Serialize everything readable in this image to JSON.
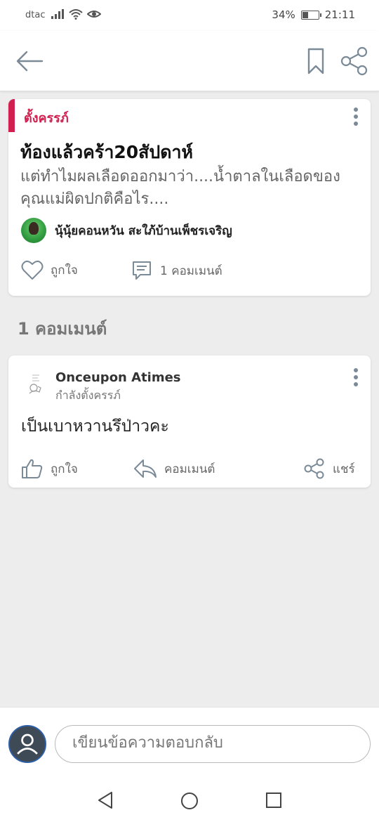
{
  "status_bar": {
    "carrier": "dtac",
    "battery_percent": "34%",
    "battery_level": 0.34,
    "time": "21:11",
    "icons": [
      "signal-icon",
      "wifi-icon",
      "eye-icon",
      "battery-icon"
    ]
  },
  "app_bar": {
    "icons": [
      "back-arrow-icon",
      "bookmark-icon",
      "share-icon"
    ]
  },
  "post": {
    "tag": "ตั้งครรภ์",
    "title": "ท้องแล้วคร้า20สัปดาห์",
    "excerpt": "แต่ทำไมผลเลือดออกมาว่า....น้ำตาลในเลือดของคุณแม่ผิดปกติคือไร....",
    "author": "นุ้นุ้ยคอนหวัน สะใภ้บ้านเพ็ชรเจริญ",
    "like_label": "ถูกใจ",
    "comment_label": "1 คอมเมนต์"
  },
  "comments_section": {
    "title": "1 คอมเมนต์"
  },
  "comment": {
    "author": "Onceupon Atimes",
    "status": "กำลังตั้งครรภ์",
    "text": "เป็นเบาหวานรึป่าวคะ",
    "like_label": "ถูกใจ",
    "reply_label": "คอมเมนต์",
    "share_label": "แชร์"
  },
  "compose": {
    "placeholder": "เขียนข้อความตอบกลับ"
  },
  "colors": {
    "accent": "#d1204f",
    "icon_gray": "#7b8a97",
    "background": "#ededee"
  }
}
